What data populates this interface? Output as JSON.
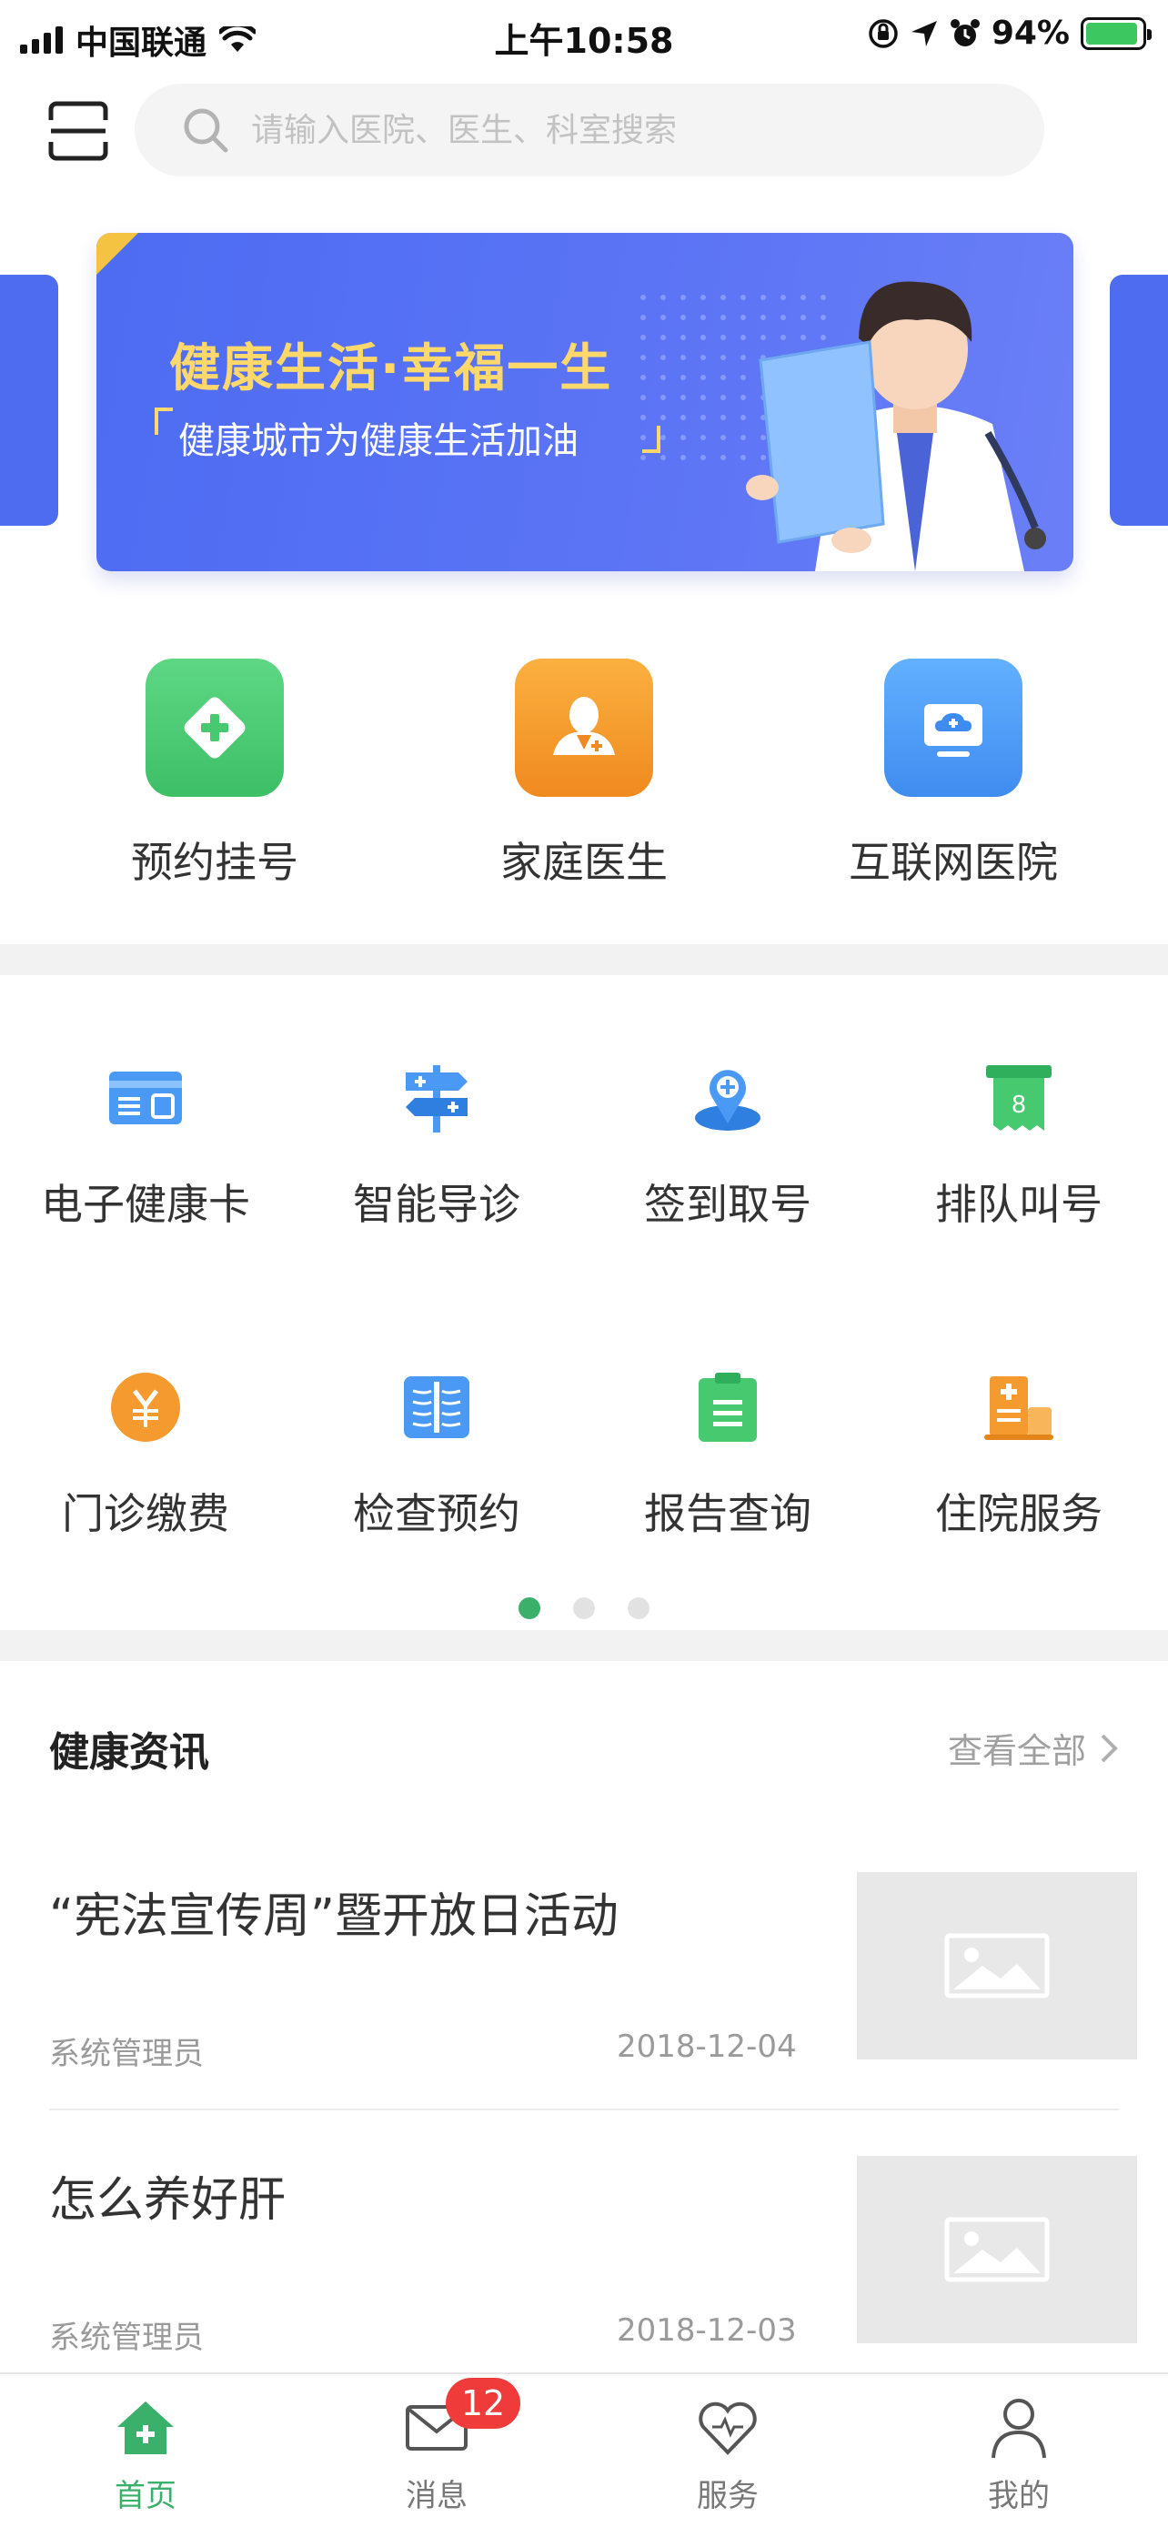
{
  "status_bar": {
    "carrier": "中国联通",
    "time": "上午10:58",
    "battery": "94%"
  },
  "search": {
    "placeholder": "请输入医院、医生、科室搜索"
  },
  "banner": {
    "title": "健康生活·幸福一生",
    "subtitle": "健康城市为健康生活加油"
  },
  "main_services": [
    {
      "label": "预约挂号",
      "icon": "plus-diamond-icon",
      "color": "#47c96f"
    },
    {
      "label": "家庭医生",
      "icon": "doctor-icon",
      "color": "#f59a2e"
    },
    {
      "label": "互联网医院",
      "icon": "cloud-monitor-icon",
      "color": "#4b9cf6"
    }
  ],
  "grid_services": [
    {
      "label": "电子健康卡",
      "icon": "health-card-icon"
    },
    {
      "label": "智能导诊",
      "icon": "signpost-icon"
    },
    {
      "label": "签到取号",
      "icon": "location-pin-icon"
    },
    {
      "label": "排队叫号",
      "icon": "queue-ticket-icon"
    },
    {
      "label": "门诊缴费",
      "icon": "yuan-coin-icon"
    },
    {
      "label": "检查预约",
      "icon": "exam-icon"
    },
    {
      "label": "报告查询",
      "icon": "report-clipboard-icon"
    },
    {
      "label": "住院服务",
      "icon": "hospital-bed-icon"
    }
  ],
  "news": {
    "title": "健康资讯",
    "view_all": "查看全部",
    "items": [
      {
        "title": "“宪法宣传周”暨开放日活动",
        "author": "系统管理员",
        "date": "2018-12-04"
      },
      {
        "title": "怎么养好肝",
        "author": "系统管理员",
        "date": "2018-12-03"
      }
    ]
  },
  "tabs": [
    {
      "label": "首页",
      "icon": "home-icon",
      "active": true
    },
    {
      "label": "消息",
      "icon": "mail-icon",
      "badge": "12"
    },
    {
      "label": "服务",
      "icon": "heart-icon"
    },
    {
      "label": "我的",
      "icon": "person-icon"
    }
  ],
  "colors": {
    "accent": "#3bb06a",
    "badge": "#f03b3b",
    "banner": "#4e6cf0"
  }
}
